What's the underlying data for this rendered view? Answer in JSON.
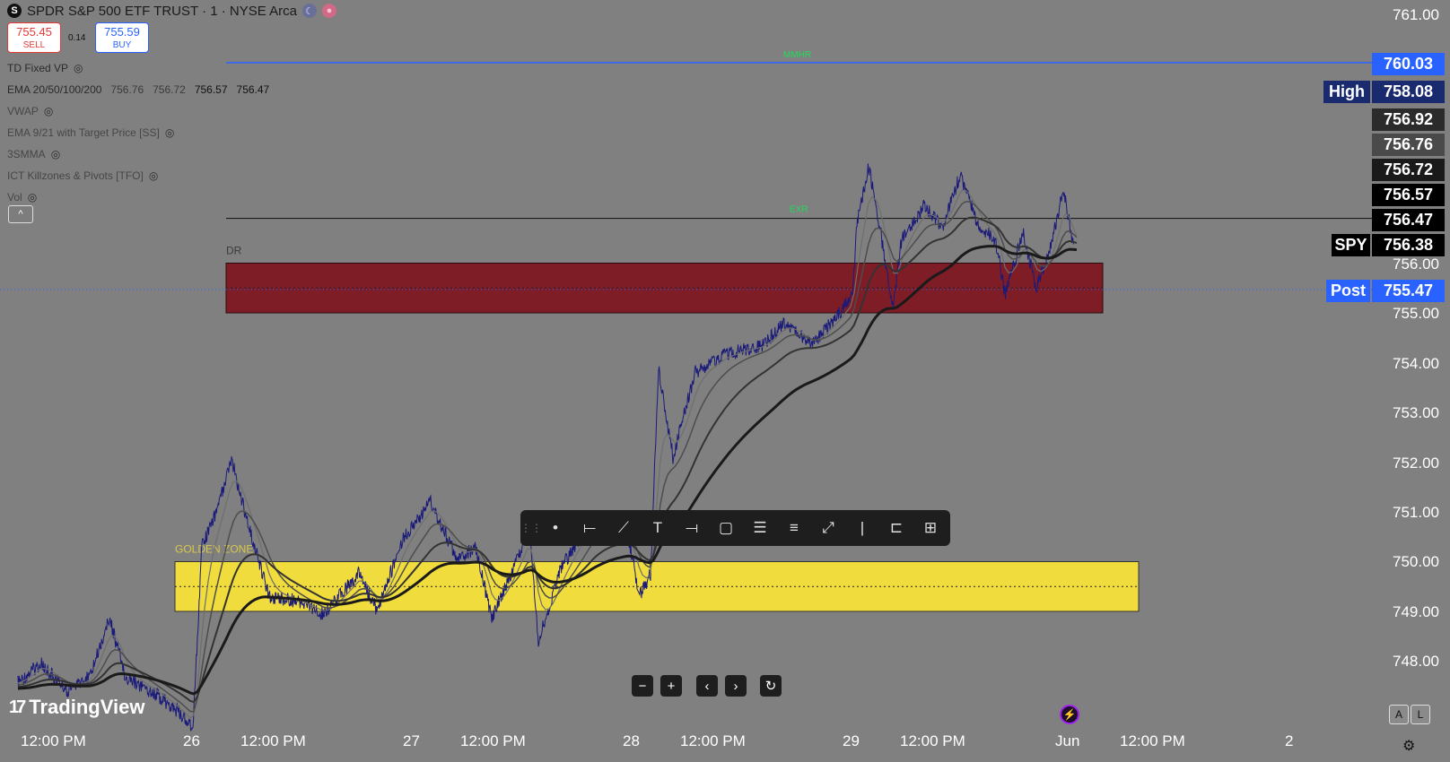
{
  "header": {
    "logo_letter": "S",
    "title": "SPDR S&P 500 ETF TRUST · 1 · NYSE Arca",
    "moon_icon": "☾",
    "dot_icon": "●"
  },
  "trade": {
    "sell_price": "755.45",
    "sell_label": "SELL",
    "spread": "0.14",
    "buy_price": "755.59",
    "buy_label": "BUY"
  },
  "indicators": [
    {
      "name": "TD Fixed VP"
    },
    {
      "name": "EMA 20/50/100/200",
      "values": [
        "756.76",
        "756.72",
        "756.57",
        "756.47"
      ]
    },
    {
      "name": "VWAP"
    },
    {
      "name": "EMA 9/21 with Target Price [SS]"
    },
    {
      "name": "3SMMA"
    },
    {
      "name": "ICT Killzones & Pivots [TFO]"
    },
    {
      "name": "Vol"
    }
  ],
  "collapse_icon": "^",
  "price_axis": {
    "ticks": [
      "761.00",
      "756.00",
      "755.00",
      "754.00",
      "753.00",
      "752.00",
      "751.00",
      "750.00",
      "749.00",
      "748.00"
    ],
    "tick_values": [
      761,
      756,
      755,
      754,
      753,
      752,
      751,
      750,
      749,
      748
    ]
  },
  "price_tags": [
    {
      "label": "",
      "value": "760.03",
      "color": "#2962ff"
    },
    {
      "label": "High",
      "value": "758.08",
      "color": "#1a2a6e"
    },
    {
      "label": "",
      "value": "756.92",
      "color": "#2b2b2b"
    },
    {
      "label": "",
      "value": "756.76",
      "color": "#4a4a4a"
    },
    {
      "label": "",
      "value": "756.72",
      "color": "#1a1a1a"
    },
    {
      "label": "",
      "value": "756.57",
      "color": "#000000"
    },
    {
      "label": "",
      "value": "756.47",
      "color": "#000000"
    },
    {
      "label": "SPY",
      "value": "756.38",
      "color": "#000000"
    },
    {
      "label": "Post",
      "value": "755.47",
      "color": "#2962ff"
    }
  ],
  "time_axis": [
    "12:00 PM",
    "26",
    "12:00 PM",
    "27",
    "12:00 PM",
    "28",
    "12:00 PM",
    "29",
    "12:00 PM",
    "Jun",
    "12:00 PM",
    "2"
  ],
  "levels": {
    "mmhr_label": "MMHR",
    "mmhr_price": 760.03,
    "exr_label": "EXR",
    "exr_price": 756.9,
    "dr_label": "DR",
    "golden_label": "GOLDEN ZONE"
  },
  "zones": {
    "dr_top": 756.0,
    "dr_bottom": 755.0,
    "dr_color": "#7f1d26",
    "golden_top": 750.0,
    "golden_bottom": 749.0,
    "golden_color": "#f0dc3c"
  },
  "colors": {
    "background": "#808080",
    "price_line": "#1a1a7a",
    "accent": "#2962ff"
  },
  "toolbar": {
    "icons": [
      "dot-icon",
      "horizontal-ray-icon",
      "trend-line-icon",
      "text-icon",
      "horizontal-line-icon",
      "rectangle-icon",
      "fib-icon",
      "parallel-channel-icon",
      "path-icon",
      "vertical-line-icon",
      "long-position-icon",
      "measure-icon"
    ],
    "glyphs": [
      "•",
      "⟝",
      "⟋",
      "T",
      "⟞",
      "▢",
      "☰",
      "≡",
      "⤢",
      "|",
      "⊏",
      "⊞"
    ]
  },
  "nav": {
    "zoom_out": "−",
    "zoom_in": "+",
    "back": "‹",
    "forward": "›",
    "reset": "↻"
  },
  "scale_buttons": {
    "auto": "A",
    "log": "L"
  },
  "settings_icon": "⚙",
  "brand": "TradingView",
  "brand_glyph": "17"
}
